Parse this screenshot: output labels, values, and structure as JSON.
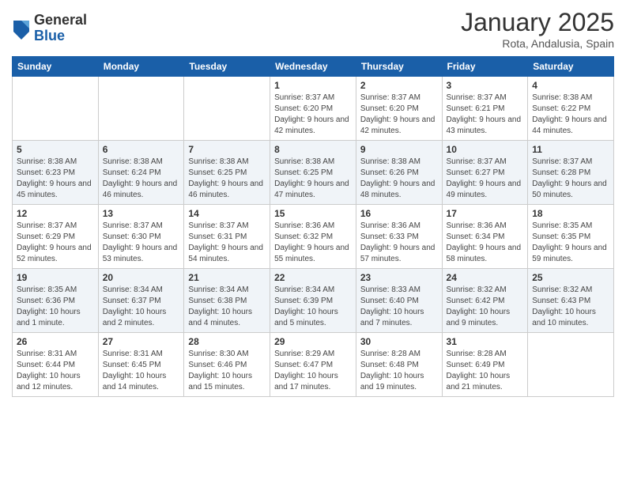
{
  "logo": {
    "general": "General",
    "blue": "Blue"
  },
  "title": "January 2025",
  "location": "Rota, Andalusia, Spain",
  "days_of_week": [
    "Sunday",
    "Monday",
    "Tuesday",
    "Wednesday",
    "Thursday",
    "Friday",
    "Saturday"
  ],
  "weeks": [
    [
      {
        "day": "",
        "info": ""
      },
      {
        "day": "",
        "info": ""
      },
      {
        "day": "",
        "info": ""
      },
      {
        "day": "1",
        "info": "Sunrise: 8:37 AM\nSunset: 6:20 PM\nDaylight: 9 hours and 42 minutes."
      },
      {
        "day": "2",
        "info": "Sunrise: 8:37 AM\nSunset: 6:20 PM\nDaylight: 9 hours and 42 minutes."
      },
      {
        "day": "3",
        "info": "Sunrise: 8:37 AM\nSunset: 6:21 PM\nDaylight: 9 hours and 43 minutes."
      },
      {
        "day": "4",
        "info": "Sunrise: 8:38 AM\nSunset: 6:22 PM\nDaylight: 9 hours and 44 minutes."
      }
    ],
    [
      {
        "day": "5",
        "info": "Sunrise: 8:38 AM\nSunset: 6:23 PM\nDaylight: 9 hours and 45 minutes."
      },
      {
        "day": "6",
        "info": "Sunrise: 8:38 AM\nSunset: 6:24 PM\nDaylight: 9 hours and 46 minutes."
      },
      {
        "day": "7",
        "info": "Sunrise: 8:38 AM\nSunset: 6:25 PM\nDaylight: 9 hours and 46 minutes."
      },
      {
        "day": "8",
        "info": "Sunrise: 8:38 AM\nSunset: 6:25 PM\nDaylight: 9 hours and 47 minutes."
      },
      {
        "day": "9",
        "info": "Sunrise: 8:38 AM\nSunset: 6:26 PM\nDaylight: 9 hours and 48 minutes."
      },
      {
        "day": "10",
        "info": "Sunrise: 8:37 AM\nSunset: 6:27 PM\nDaylight: 9 hours and 49 minutes."
      },
      {
        "day": "11",
        "info": "Sunrise: 8:37 AM\nSunset: 6:28 PM\nDaylight: 9 hours and 50 minutes."
      }
    ],
    [
      {
        "day": "12",
        "info": "Sunrise: 8:37 AM\nSunset: 6:29 PM\nDaylight: 9 hours and 52 minutes."
      },
      {
        "day": "13",
        "info": "Sunrise: 8:37 AM\nSunset: 6:30 PM\nDaylight: 9 hours and 53 minutes."
      },
      {
        "day": "14",
        "info": "Sunrise: 8:37 AM\nSunset: 6:31 PM\nDaylight: 9 hours and 54 minutes."
      },
      {
        "day": "15",
        "info": "Sunrise: 8:36 AM\nSunset: 6:32 PM\nDaylight: 9 hours and 55 minutes."
      },
      {
        "day": "16",
        "info": "Sunrise: 8:36 AM\nSunset: 6:33 PM\nDaylight: 9 hours and 57 minutes."
      },
      {
        "day": "17",
        "info": "Sunrise: 8:36 AM\nSunset: 6:34 PM\nDaylight: 9 hours and 58 minutes."
      },
      {
        "day": "18",
        "info": "Sunrise: 8:35 AM\nSunset: 6:35 PM\nDaylight: 9 hours and 59 minutes."
      }
    ],
    [
      {
        "day": "19",
        "info": "Sunrise: 8:35 AM\nSunset: 6:36 PM\nDaylight: 10 hours and 1 minute."
      },
      {
        "day": "20",
        "info": "Sunrise: 8:34 AM\nSunset: 6:37 PM\nDaylight: 10 hours and 2 minutes."
      },
      {
        "day": "21",
        "info": "Sunrise: 8:34 AM\nSunset: 6:38 PM\nDaylight: 10 hours and 4 minutes."
      },
      {
        "day": "22",
        "info": "Sunrise: 8:34 AM\nSunset: 6:39 PM\nDaylight: 10 hours and 5 minutes."
      },
      {
        "day": "23",
        "info": "Sunrise: 8:33 AM\nSunset: 6:40 PM\nDaylight: 10 hours and 7 minutes."
      },
      {
        "day": "24",
        "info": "Sunrise: 8:32 AM\nSunset: 6:42 PM\nDaylight: 10 hours and 9 minutes."
      },
      {
        "day": "25",
        "info": "Sunrise: 8:32 AM\nSunset: 6:43 PM\nDaylight: 10 hours and 10 minutes."
      }
    ],
    [
      {
        "day": "26",
        "info": "Sunrise: 8:31 AM\nSunset: 6:44 PM\nDaylight: 10 hours and 12 minutes."
      },
      {
        "day": "27",
        "info": "Sunrise: 8:31 AM\nSunset: 6:45 PM\nDaylight: 10 hours and 14 minutes."
      },
      {
        "day": "28",
        "info": "Sunrise: 8:30 AM\nSunset: 6:46 PM\nDaylight: 10 hours and 15 minutes."
      },
      {
        "day": "29",
        "info": "Sunrise: 8:29 AM\nSunset: 6:47 PM\nDaylight: 10 hours and 17 minutes."
      },
      {
        "day": "30",
        "info": "Sunrise: 8:28 AM\nSunset: 6:48 PM\nDaylight: 10 hours and 19 minutes."
      },
      {
        "day": "31",
        "info": "Sunrise: 8:28 AM\nSunset: 6:49 PM\nDaylight: 10 hours and 21 minutes."
      },
      {
        "day": "",
        "info": ""
      }
    ]
  ]
}
